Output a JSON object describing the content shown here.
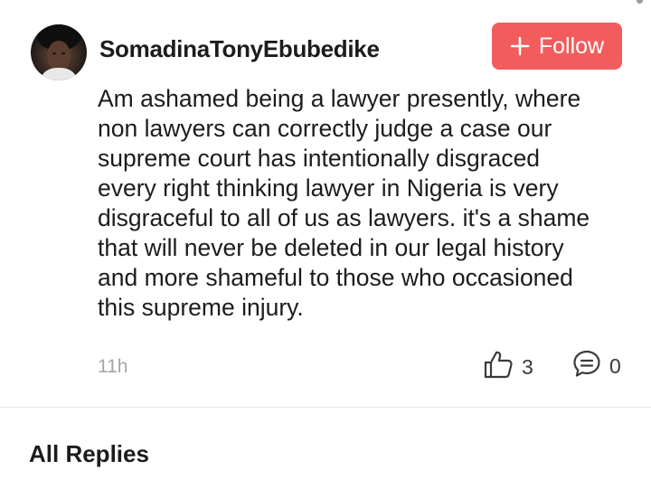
{
  "post": {
    "author": "SomadinaTonyEbubedike",
    "follow_label": "Follow",
    "follow_icon": "plus-icon",
    "comment_lines": [
      "Am ashamed being a lawyer presently, where",
      "non lawyers can correctly judge a case our",
      "supreme court has intentionally disgraced",
      "every right thinking lawyer in Nigeria is very",
      "disgraceful to all of us as lawyers. it's a shame",
      "that will never be deleted in our legal history",
      "and more shameful to those who occasioned",
      "this supreme injury."
    ],
    "time": "11h",
    "likes": "3",
    "like_icon": "thumbs-up-icon",
    "replies": "0",
    "reply_icon": "comment-bubble-icon"
  },
  "replies_section": {
    "title": "All Replies"
  },
  "colors": {
    "follow_bg": "#f25c5c",
    "timestamp": "#a6a6a6",
    "divider": "#e6e6e6"
  }
}
